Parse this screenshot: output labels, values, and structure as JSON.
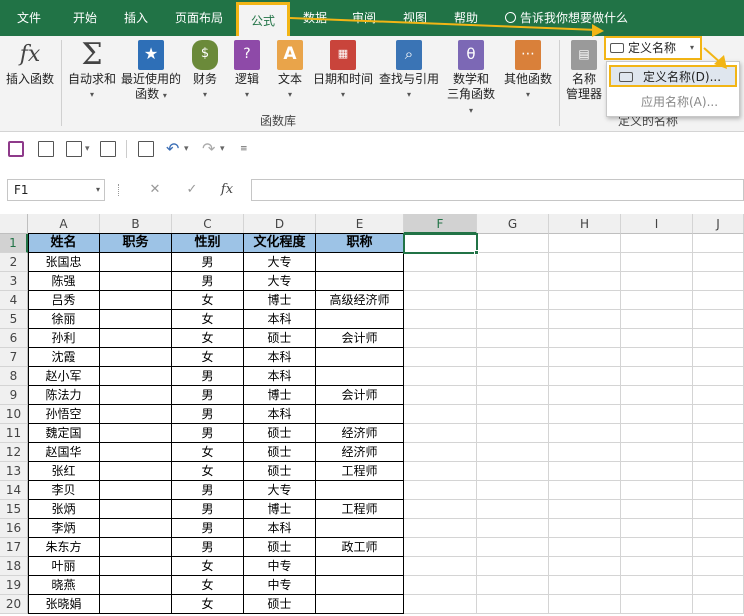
{
  "tabs": [
    "文件",
    "开始",
    "插入",
    "页面布局",
    "公式",
    "数据",
    "审阅",
    "视图",
    "帮助"
  ],
  "tell_me": "告诉我你想要做什么",
  "ribbon": {
    "insert_function": "插入函数",
    "autosum": "自动求和",
    "recent_line1": "最近使用的",
    "recent_line2": "函数",
    "financial": "财务",
    "logical": "逻辑",
    "text": "文本",
    "datetime": "日期和时间",
    "lookup": "查找与引用",
    "math_line1": "数学和",
    "math_line2": "三角函数",
    "more": "其他函数",
    "name_mgr_line1": "名称",
    "name_mgr_line2": "管理器",
    "group_library": "函数库",
    "define_name": "定义名称",
    "group_names": "定义的名称"
  },
  "dropdown": {
    "item1": "定义名称(D)...",
    "item2": "应用名称(A)..."
  },
  "formula_bar": {
    "name_box": "F1",
    "cancel": "✕",
    "enter": "✓",
    "fx": "fx",
    "value": ""
  },
  "sheet": {
    "columns": [
      "A",
      "B",
      "C",
      "D",
      "E",
      "F",
      "G",
      "H",
      "I",
      "J"
    ],
    "rows": [
      "1",
      "2",
      "3",
      "4",
      "5",
      "6",
      "7",
      "8",
      "9",
      "10",
      "11",
      "12",
      "13",
      "14",
      "15",
      "16",
      "17",
      "18",
      "19",
      "20"
    ],
    "selected": "F1",
    "table": [
      [
        "姓名",
        "职务",
        "性别",
        "文化程度",
        "职称"
      ],
      [
        "张国忠",
        "",
        "男",
        "大专",
        ""
      ],
      [
        "陈强",
        "",
        "男",
        "大专",
        ""
      ],
      [
        "吕秀",
        "",
        "女",
        "博士",
        "高级经济师"
      ],
      [
        "徐丽",
        "",
        "女",
        "本科",
        ""
      ],
      [
        "孙利",
        "",
        "女",
        "硕士",
        "会计师"
      ],
      [
        "沈霞",
        "",
        "女",
        "本科",
        ""
      ],
      [
        "赵小军",
        "",
        "男",
        "本科",
        ""
      ],
      [
        "陈法力",
        "",
        "男",
        "博士",
        "会计师"
      ],
      [
        "孙悟空",
        "",
        "男",
        "本科",
        ""
      ],
      [
        "魏定国",
        "",
        "男",
        "硕士",
        "经济师"
      ],
      [
        "赵国华",
        "",
        "女",
        "硕士",
        "经济师"
      ],
      [
        "张红",
        "",
        "女",
        "硕士",
        "工程师"
      ],
      [
        "李贝",
        "",
        "男",
        "大专",
        ""
      ],
      [
        "张炳",
        "",
        "男",
        "博士",
        "工程师"
      ],
      [
        "李炳",
        "",
        "男",
        "本科",
        ""
      ],
      [
        "朱东方",
        "",
        "男",
        "硕士",
        "政工师"
      ],
      [
        "叶丽",
        "",
        "女",
        "中专",
        ""
      ],
      [
        "晓燕",
        "",
        "女",
        "中专",
        ""
      ],
      [
        "张晓娟",
        "",
        "女",
        "硕士",
        ""
      ]
    ]
  },
  "colors": {
    "ribbon_green": "#217346",
    "highlight": "#f2b515",
    "header_fill": "#9dc3e6"
  }
}
